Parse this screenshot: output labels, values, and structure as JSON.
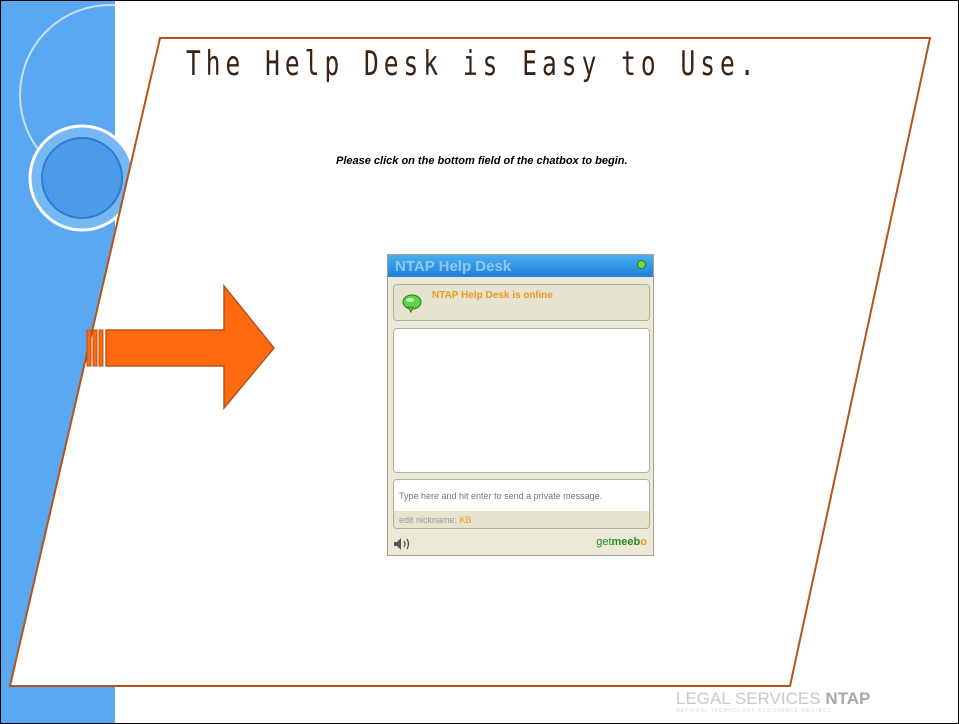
{
  "slide": {
    "title": "The Help Desk is Easy to Use.",
    "instruction": "Please click on the bottom field of the chatbox to begin."
  },
  "chat_widget": {
    "title": "NTAP Help Desk",
    "status_text": "NTAP Help Desk is online",
    "input_placeholder": "Type here and hit enter to send a private message.",
    "nickname_label": "edit nickname:",
    "nickname_value": "KB",
    "brand_get": "get",
    "brand_name": "meeb",
    "brand_o": "o"
  },
  "footer": {
    "logo_main": "LEGAL SERVICES",
    "logo_ntap": "NTAP",
    "logo_sub": "NATIONAL TECHNOLOGY ASSISTANCE PROJECT"
  },
  "colors": {
    "accent_blue": "#5aa7f2",
    "arrow_orange": "#ff6a10",
    "frame_brown": "#b5541a",
    "status_orange": "#f0981c"
  },
  "icons": [
    "speech-bubble-icon",
    "speaker-icon",
    "status-online-icon",
    "right-arrow-icon"
  ]
}
